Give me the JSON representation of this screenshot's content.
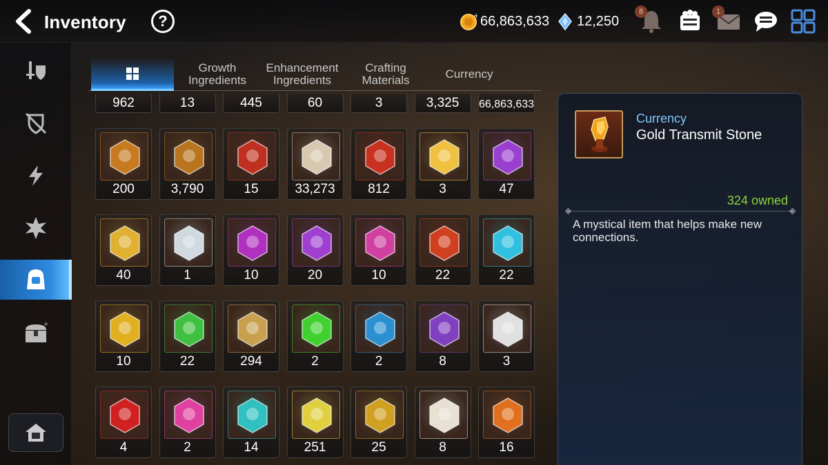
{
  "header": {
    "title": "Inventory",
    "help_label": "?",
    "gold": "66,863,633",
    "crystals": "12,250",
    "notification_badge": "8",
    "mail_badge": "1"
  },
  "left_nav": {
    "items": [
      {
        "name": "equipment-icon"
      },
      {
        "name": "shield-icon"
      },
      {
        "name": "lightning-icon"
      },
      {
        "name": "burst-icon"
      },
      {
        "name": "bag-icon",
        "active": true
      },
      {
        "name": "chest-icon"
      }
    ],
    "house_icon": "house-icon"
  },
  "tabs": [
    {
      "label": "",
      "icon": "grid-icon",
      "active": true
    },
    {
      "label": "Growth\nIngredients"
    },
    {
      "label": "Enhancement\nIngredients"
    },
    {
      "label": "Crafting\nMaterials"
    },
    {
      "label": "Currency"
    }
  ],
  "grid": {
    "top_row_counts": [
      "962",
      "13",
      "445",
      "60",
      "3",
      "3,325",
      "66,863,633"
    ],
    "rows": [
      [
        {
          "count": "200",
          "icon": "hex-shield-icon",
          "tint": "#c77a20"
        },
        {
          "count": "3,790",
          "icon": "fist-badge-icon",
          "tint": "#b8741e"
        },
        {
          "count": "15",
          "icon": "banner-icon",
          "tint": "#c03020"
        },
        {
          "count": "33,273",
          "icon": "knight-piece-icon",
          "tint": "#d8c8b0"
        },
        {
          "count": "812",
          "icon": "red-leaf-icon",
          "tint": "#c83020"
        },
        {
          "count": "3",
          "icon": "chibi-face-icon",
          "tint": "#f0c040"
        },
        {
          "count": "47",
          "icon": "purple-flower-icon",
          "tint": "#9a40d0"
        }
      ],
      [
        {
          "count": "40",
          "icon": "gold-flower-icon",
          "tint": "#e0b030"
        },
        {
          "count": "1",
          "icon": "silver-flower-icon",
          "tint": "#d0d8e0"
        },
        {
          "count": "10",
          "icon": "purple-gem-icon",
          "tint": "#b030c0"
        },
        {
          "count": "20",
          "icon": "purple-triangle-gem-icon",
          "tint": "#a040d0"
        },
        {
          "count": "10",
          "icon": "pink-egg-gem-icon",
          "tint": "#d040a0"
        },
        {
          "count": "22",
          "icon": "red-egg-gem-icon",
          "tint": "#d04020"
        },
        {
          "count": "22",
          "icon": "cyan-egg-gem-icon",
          "tint": "#30c0e0"
        }
      ],
      [
        {
          "count": "10",
          "icon": "yellow-egg-gem-icon",
          "tint": "#e0b020"
        },
        {
          "count": "22",
          "icon": "green-egg-gem-icon",
          "tint": "#40c040"
        },
        {
          "count": "294",
          "icon": "golden-feather-icon",
          "tint": "#c8a050"
        },
        {
          "count": "2",
          "icon": "green-potion-icon",
          "tint": "#40d030"
        },
        {
          "count": "2",
          "icon": "blue-rune-icon",
          "tint": "#2a90d0"
        },
        {
          "count": "8",
          "icon": "pet-ticket-icon",
          "tint": "#8040c0"
        },
        {
          "count": "3",
          "icon": "staff-icon",
          "tint": "#e0e0e0"
        }
      ],
      [
        {
          "count": "4",
          "icon": "red-shard-icon",
          "tint": "#d02020"
        },
        {
          "count": "2",
          "icon": "pink-potion-icon",
          "tint": "#e040a0"
        },
        {
          "count": "14",
          "icon": "teal-shard-icon",
          "tint": "#30c0c0"
        },
        {
          "count": "251",
          "icon": "yellow-stone-icon",
          "tint": "#e0d040"
        },
        {
          "count": "25",
          "icon": "amber-stone-icon",
          "tint": "#d0a020"
        },
        {
          "count": "8",
          "icon": "white-stone-icon",
          "tint": "#e8e0d0"
        },
        {
          "count": "16",
          "icon": "orange-stone-icon",
          "tint": "#e07020"
        }
      ]
    ]
  },
  "detail": {
    "category": "Currency",
    "name": "Gold Transmit Stone",
    "owned": "324 owned",
    "description": "A mystical item that helps make new connections.",
    "icon": "gold-transmit-stone-icon"
  }
}
